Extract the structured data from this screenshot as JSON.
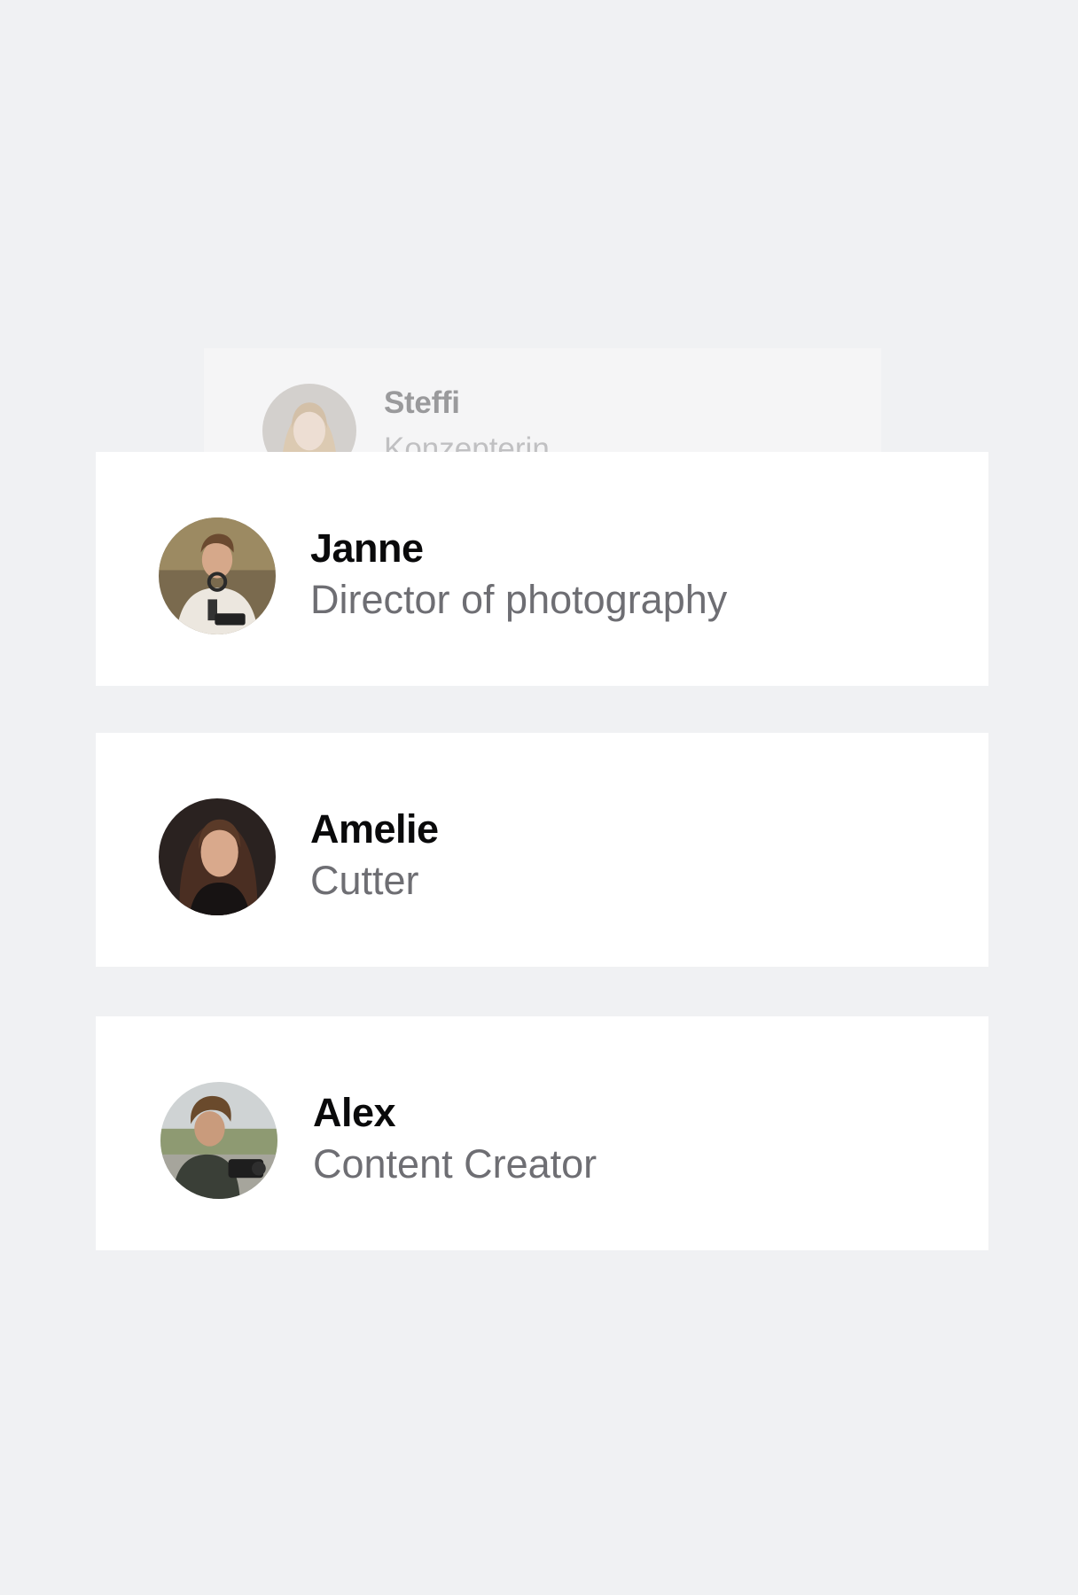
{
  "team": {
    "members": [
      {
        "name": "Steffi",
        "role": "Konzepterin",
        "avatar_icon": "person-photo-icon",
        "state": "faded-background"
      },
      {
        "name": "Janne",
        "role": "Director of photography",
        "avatar_icon": "person-photo-icon"
      },
      {
        "name": "Amelie",
        "role": "Cutter",
        "avatar_icon": "person-photo-icon"
      },
      {
        "name": "Alex",
        "role": "Content Creator",
        "avatar_icon": "person-photo-icon"
      }
    ]
  },
  "colors": {
    "background": "#f0f1f3",
    "card": "#ffffff",
    "name_text": "#0a0a0b",
    "role_text": "#6e6e73"
  }
}
